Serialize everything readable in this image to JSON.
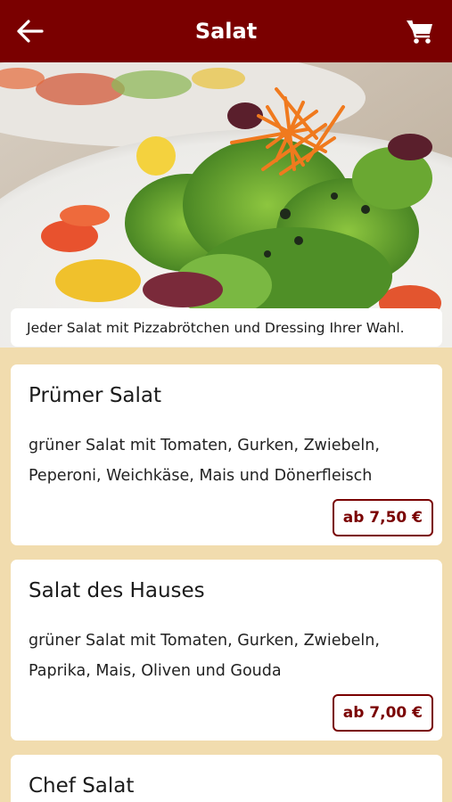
{
  "header": {
    "title": "Salat",
    "back_icon": "arrow-left-icon",
    "cart_icon": "cart-icon",
    "bar_color": "#7a0000"
  },
  "info": {
    "text": "Jeder Salat mit Pizzabrötchen und Dressing Ihrer Wahl."
  },
  "items": [
    {
      "name": "Prümer Salat",
      "description": "grüner Salat mit Tomaten, Gurken, Zwiebeln, Peperoni, Weichkäse, Mais und Dönerfleisch",
      "price": "ab 7,50 €"
    },
    {
      "name": "Salat des Hauses",
      "description": "grüner Salat mit Tomaten, Gurken, Zwiebeln, Paprika, Mais, Oliven und Gouda",
      "price": "ab 7,00 €"
    },
    {
      "name": "Chef Salat"
    }
  ],
  "colors": {
    "background": "#f1dcae",
    "accent": "#7a0000",
    "card": "#ffffff"
  }
}
